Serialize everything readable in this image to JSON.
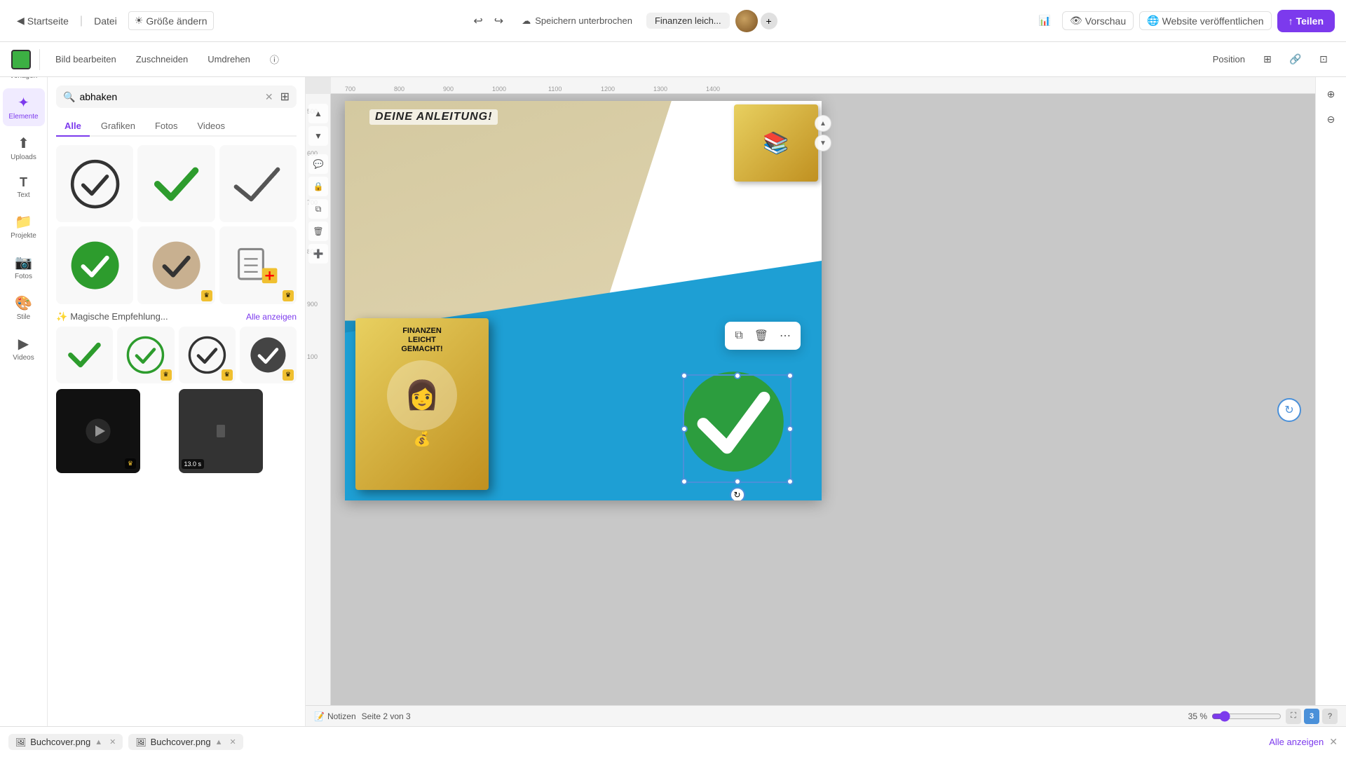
{
  "topbar": {
    "home_label": "Startseite",
    "file_label": "Datei",
    "resize_label": "Größe ändern",
    "undo_icon": "↩",
    "redo_icon": "↪",
    "save_status": "Speichern unterbrochen",
    "project_title": "Finanzen leich...",
    "add_page_icon": "+",
    "stats_icon": "📊",
    "preview_label": "Vorschau",
    "publish_label": "Website veröffentlichen",
    "share_label": "Teilen",
    "share_icon": "↑"
  },
  "toolbar2": {
    "color": "#3cb043",
    "edit_image_label": "Bild bearbeiten",
    "crop_label": "Zuschneiden",
    "flip_label": "Umdrehen",
    "info_icon": "ⓘ",
    "position_label": "Position"
  },
  "sidebar": {
    "items": [
      {
        "icon": "☰",
        "label": "Vorlagen"
      },
      {
        "icon": "✦",
        "label": "Elemente"
      },
      {
        "icon": "⬆",
        "label": "Uploads"
      },
      {
        "icon": "T",
        "label": "Text"
      },
      {
        "icon": "📁",
        "label": "Projekte"
      },
      {
        "icon": "📷",
        "label": "Fotos"
      },
      {
        "icon": "🎨",
        "label": "Stile"
      },
      {
        "icon": "▶",
        "label": "Videos"
      }
    ],
    "active_index": 1
  },
  "search": {
    "query": "abhaken",
    "placeholder": "abhaken",
    "tabs": [
      "Alle",
      "Grafiken",
      "Fotos",
      "Videos"
    ],
    "active_tab": "Alle"
  },
  "search_results": {
    "items": [
      {
        "id": 1,
        "type": "circle-check-outline",
        "premium": false
      },
      {
        "id": 2,
        "type": "green-check",
        "premium": false
      },
      {
        "id": 3,
        "type": "sketch-check",
        "premium": false
      },
      {
        "id": 4,
        "type": "green-circle-check",
        "premium": false
      },
      {
        "id": 5,
        "type": "tan-circle-check",
        "premium": true
      },
      {
        "id": 6,
        "type": "checklist-red",
        "premium": true
      }
    ],
    "magic_section_title": "Magische Empfehlung...",
    "magic_show_all": "Alle anzeigen",
    "magic_items": [
      {
        "id": 1,
        "type": "green-check-simple",
        "premium": false
      },
      {
        "id": 2,
        "type": "green-circle-check2",
        "premium": true
      },
      {
        "id": 3,
        "type": "dark-circle-check",
        "premium": true
      },
      {
        "id": 4,
        "type": "dark-fill-check",
        "premium": true
      }
    ],
    "video_items": [
      {
        "id": 1,
        "duration": "",
        "type": "black-bg"
      },
      {
        "id": 2,
        "duration": "13.0 s",
        "type": "person-video"
      }
    ]
  },
  "statusbar": {
    "notes_label": "Notizen",
    "page_indicator": "Seite 2 von 3",
    "zoom_pct": "35 %",
    "zoom_value": 35
  },
  "filesbar": {
    "file1": "Buchcover.png",
    "file2": "Buchcover.png",
    "show_all_label": "Alle anzeigen"
  },
  "canvas": {
    "header_text": "Deine Anleitung!",
    "book_title_line1": "FINANZEN",
    "book_title_line2": "LEICHT",
    "book_title_line3": "GEMACHT!"
  },
  "ruler": {
    "marks": [
      "700",
      "800",
      "900",
      "1000",
      "1100",
      "1200",
      "1300",
      "1400"
    ]
  },
  "context_menu": {
    "copy_icon": "⧉",
    "delete_icon": "🗑",
    "more_icon": "⋯"
  }
}
